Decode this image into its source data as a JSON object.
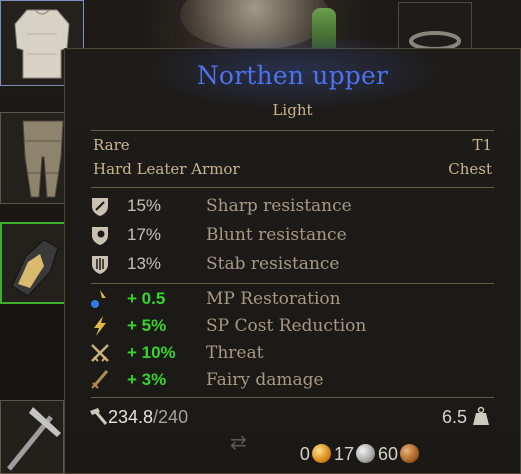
{
  "tooltip": {
    "name": "Northen upper",
    "weight_class": "Light",
    "rarity": "Rare",
    "tier": "T1",
    "armor_type": "Hard Leater Armor",
    "slot": "Chest",
    "resistances": [
      {
        "icon": "sharp-shield-icon",
        "value": "15%",
        "label": "Sharp resistance"
      },
      {
        "icon": "blunt-shield-icon",
        "value": "17%",
        "label": "Blunt resistance"
      },
      {
        "icon": "stab-shield-icon",
        "value": "13%",
        "label": "Stab resistance"
      }
    ],
    "bonuses": [
      {
        "icon": "mp-restoration-icon",
        "value": "+ 0.5",
        "label": "MP Restoration"
      },
      {
        "icon": "lightning-icon",
        "value": "+ 5%",
        "label": "SP Cost Reduction"
      },
      {
        "icon": "crossed-swords-icon",
        "value": "+ 10%",
        "label": "Threat"
      },
      {
        "icon": "fairy-sword-icon",
        "value": "+ 3%",
        "label": "Fairy damage"
      }
    ],
    "durability_current": "234.8",
    "durability_max": "/240",
    "weight": "6.5",
    "price": {
      "gold": "0",
      "silver": "17",
      "copper": "60"
    }
  },
  "colors": {
    "item_name": "#4c72ee",
    "bonus_value": "#38d42c",
    "selected_slot": "#3fae2e"
  }
}
